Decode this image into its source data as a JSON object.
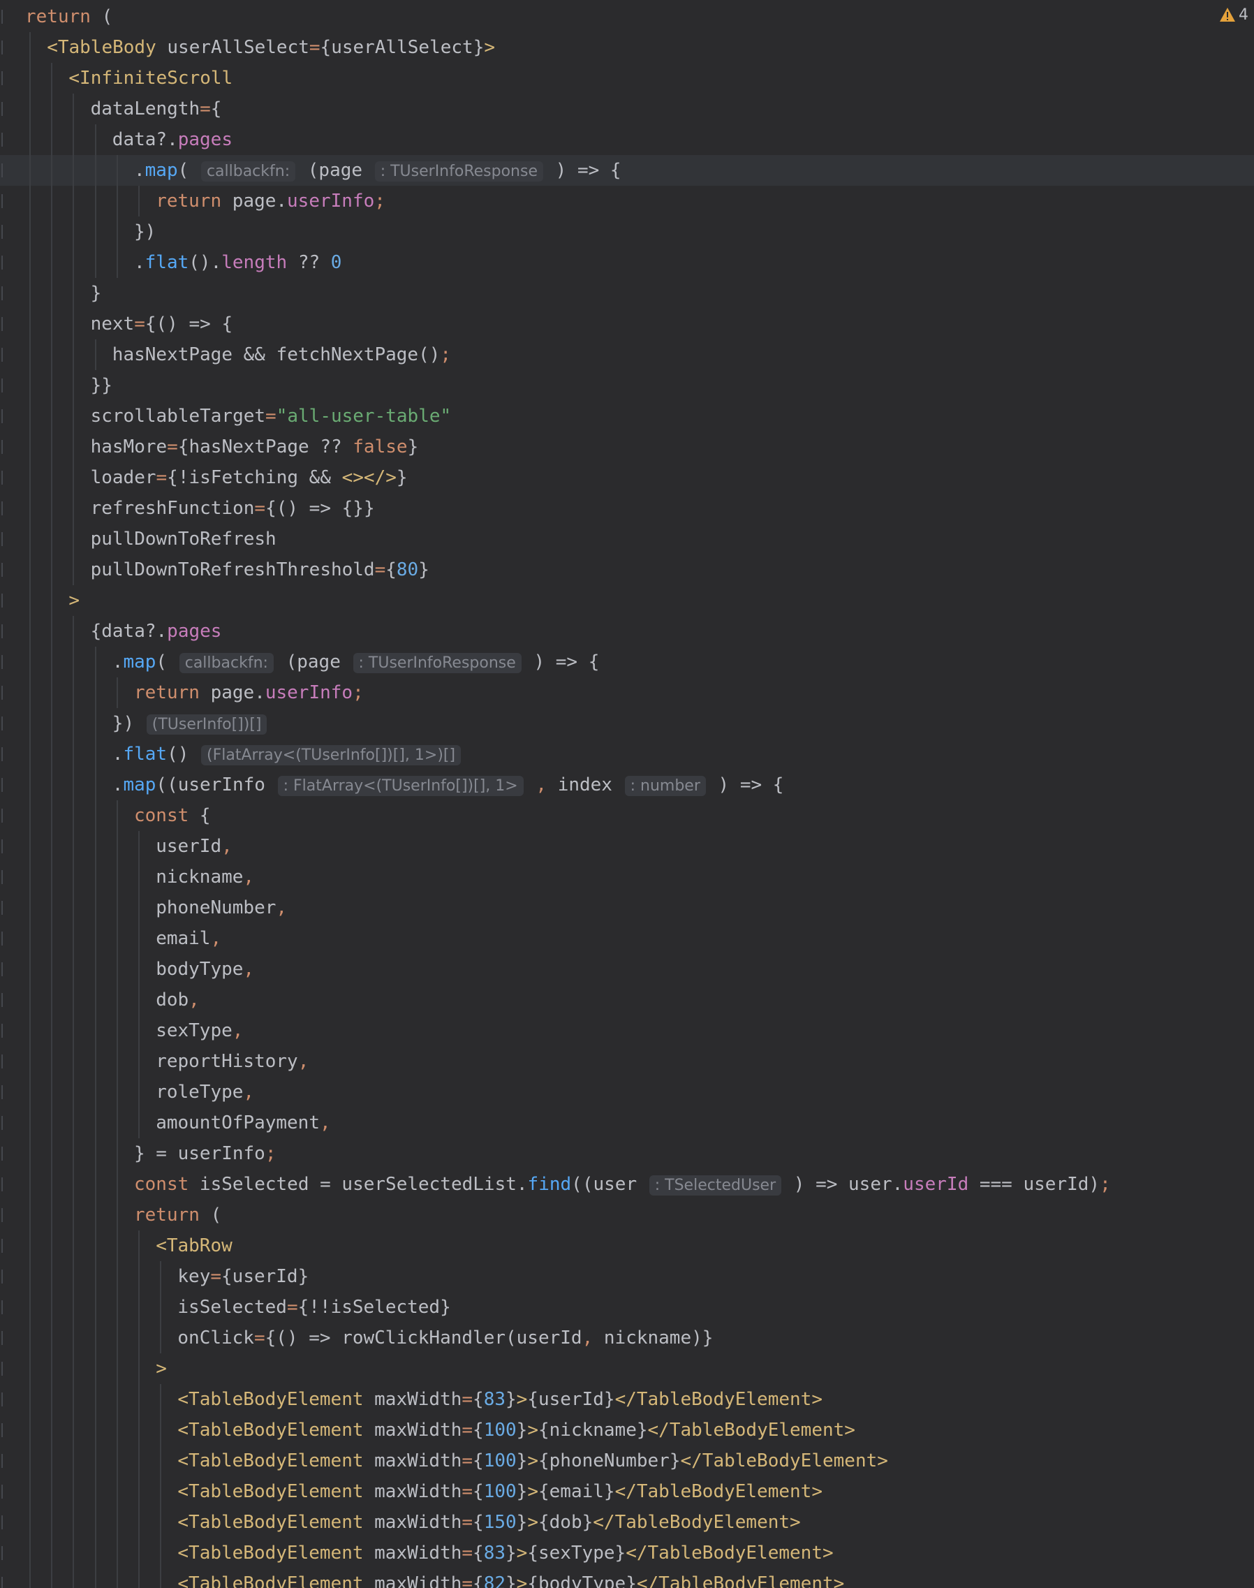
{
  "editor": {
    "warning_count": "4",
    "colors": {
      "background": "#2b2b2d",
      "text": "#bcbec4",
      "keyword": "#cf8e6d",
      "tag": "#d5b778",
      "number": "#6aabe4",
      "string": "#6aab73",
      "property": "#c77dbb",
      "function": "#56a8f5",
      "hint": "#868991",
      "warning": "#e5a23b"
    },
    "lines": [
      {
        "indent": 0,
        "tokens": [
          [
            "return",
            "kw"
          ],
          [
            " (",
            ""
          ]
        ]
      },
      {
        "indent": 1,
        "tokens": [
          [
            "<TableBody",
            "tag"
          ],
          [
            " userAllSelect",
            ""
          ],
          [
            "=",
            "kw"
          ],
          [
            "{userAllSelect}",
            ""
          ],
          [
            ">",
            "tag"
          ]
        ]
      },
      {
        "indent": 2,
        "tokens": [
          [
            "<InfiniteScroll",
            "tag"
          ]
        ]
      },
      {
        "indent": 3,
        "tokens": [
          [
            "dataLength",
            ""
          ],
          [
            "=",
            "kw"
          ],
          [
            "{",
            ""
          ]
        ]
      },
      {
        "indent": 4,
        "tokens": [
          [
            "data?.",
            ""
          ],
          [
            "pages",
            "prop"
          ]
        ]
      },
      {
        "indent": 5,
        "current": true,
        "tokens": [
          [
            ".",
            ""
          ],
          [
            "map",
            "fn"
          ],
          [
            "( ",
            ""
          ],
          [
            "callbackfn:",
            "hint"
          ],
          [
            " (page ",
            ""
          ],
          [
            ": TUserInfoResponse",
            "hint"
          ],
          [
            " ) => {",
            ""
          ]
        ]
      },
      {
        "indent": 6,
        "tokens": [
          [
            "return",
            "kw"
          ],
          [
            " page.",
            ""
          ],
          [
            "userInfo",
            "prop"
          ],
          [
            ";",
            "kw"
          ]
        ]
      },
      {
        "indent": 5,
        "tokens": [
          [
            "})",
            ""
          ]
        ]
      },
      {
        "indent": 5,
        "tokens": [
          [
            ".",
            ""
          ],
          [
            "flat",
            "fn"
          ],
          [
            "().",
            ""
          ],
          [
            "length",
            "prop"
          ],
          [
            " ?? ",
            ""
          ],
          [
            "0",
            "num"
          ]
        ]
      },
      {
        "indent": 3,
        "tokens": [
          [
            "}",
            ""
          ]
        ]
      },
      {
        "indent": 3,
        "tokens": [
          [
            "next",
            ""
          ],
          [
            "=",
            "kw"
          ],
          [
            "{() => {",
            ""
          ]
        ]
      },
      {
        "indent": 4,
        "tokens": [
          [
            "hasNextPage && fetchNextPage()",
            ""
          ],
          [
            ";",
            "kw"
          ]
        ]
      },
      {
        "indent": 3,
        "tokens": [
          [
            "}}",
            ""
          ]
        ]
      },
      {
        "indent": 3,
        "tokens": [
          [
            "scrollableTarget",
            ""
          ],
          [
            "=",
            "kw"
          ],
          [
            "\"all-user-table\"",
            "str"
          ]
        ]
      },
      {
        "indent": 3,
        "tokens": [
          [
            "hasMore",
            ""
          ],
          [
            "=",
            "kw"
          ],
          [
            "{hasNextPage ?? ",
            ""
          ],
          [
            "false",
            "kw"
          ],
          [
            "}",
            ""
          ]
        ]
      },
      {
        "indent": 3,
        "tokens": [
          [
            "loader",
            ""
          ],
          [
            "=",
            "kw"
          ],
          [
            "{!isFetching && ",
            ""
          ],
          [
            "<></>",
            "tag"
          ],
          [
            "}",
            ""
          ]
        ]
      },
      {
        "indent": 3,
        "tokens": [
          [
            "refreshFunction",
            ""
          ],
          [
            "=",
            "kw"
          ],
          [
            "{() => {}}",
            ""
          ]
        ]
      },
      {
        "indent": 3,
        "tokens": [
          [
            "pullDownToRefresh",
            ""
          ]
        ]
      },
      {
        "indent": 3,
        "tokens": [
          [
            "pullDownToRefreshThreshold",
            ""
          ],
          [
            "=",
            "kw"
          ],
          [
            "{",
            ""
          ],
          [
            "80",
            "num"
          ],
          [
            "}",
            ""
          ]
        ]
      },
      {
        "indent": 2,
        "tokens": [
          [
            ">",
            "tag"
          ]
        ]
      },
      {
        "indent": 3,
        "tokens": [
          [
            "{data?.",
            ""
          ],
          [
            "pages",
            "prop"
          ]
        ]
      },
      {
        "indent": 4,
        "tokens": [
          [
            ".",
            ""
          ],
          [
            "map",
            "fn"
          ],
          [
            "( ",
            ""
          ],
          [
            "callbackfn:",
            "hint"
          ],
          [
            " (page ",
            ""
          ],
          [
            ": TUserInfoResponse",
            "hint"
          ],
          [
            " ) => {",
            ""
          ]
        ]
      },
      {
        "indent": 5,
        "tokens": [
          [
            "return",
            "kw"
          ],
          [
            " page.",
            ""
          ],
          [
            "userInfo",
            "prop"
          ],
          [
            ";",
            "kw"
          ]
        ]
      },
      {
        "indent": 4,
        "tokens": [
          [
            "}) ",
            ""
          ],
          [
            "(TUserInfo[])[]",
            "hint"
          ]
        ]
      },
      {
        "indent": 4,
        "tokens": [
          [
            ".",
            ""
          ],
          [
            "flat",
            "fn"
          ],
          [
            "() ",
            ""
          ],
          [
            "(FlatArray<(TUserInfo[])[], 1>)[]",
            "hint"
          ]
        ]
      },
      {
        "indent": 4,
        "tokens": [
          [
            ".",
            ""
          ],
          [
            "map",
            "fn"
          ],
          [
            "((userInfo ",
            ""
          ],
          [
            ": FlatArray<(TUserInfo[])[], 1>",
            "hint"
          ],
          [
            " , ",
            "kw"
          ],
          [
            "index ",
            ""
          ],
          [
            ": number",
            "hint"
          ],
          [
            " ) => {",
            ""
          ]
        ]
      },
      {
        "indent": 5,
        "tokens": [
          [
            "const",
            "kw"
          ],
          [
            " {",
            ""
          ]
        ]
      },
      {
        "indent": 6,
        "tokens": [
          [
            "userId",
            ""
          ],
          [
            ",",
            "kw"
          ]
        ]
      },
      {
        "indent": 6,
        "tokens": [
          [
            "nickname",
            ""
          ],
          [
            ",",
            "kw"
          ]
        ]
      },
      {
        "indent": 6,
        "tokens": [
          [
            "phoneNumber",
            ""
          ],
          [
            ",",
            "kw"
          ]
        ]
      },
      {
        "indent": 6,
        "tokens": [
          [
            "email",
            ""
          ],
          [
            ",",
            "kw"
          ]
        ]
      },
      {
        "indent": 6,
        "tokens": [
          [
            "bodyType",
            ""
          ],
          [
            ",",
            "kw"
          ]
        ]
      },
      {
        "indent": 6,
        "tokens": [
          [
            "dob",
            ""
          ],
          [
            ",",
            "kw"
          ]
        ]
      },
      {
        "indent": 6,
        "tokens": [
          [
            "sexType",
            ""
          ],
          [
            ",",
            "kw"
          ]
        ]
      },
      {
        "indent": 6,
        "tokens": [
          [
            "reportHistory",
            ""
          ],
          [
            ",",
            "kw"
          ]
        ]
      },
      {
        "indent": 6,
        "tokens": [
          [
            "roleType",
            ""
          ],
          [
            ",",
            "kw"
          ]
        ]
      },
      {
        "indent": 6,
        "tokens": [
          [
            "amountOfPayment",
            ""
          ],
          [
            ",",
            "kw"
          ]
        ]
      },
      {
        "indent": 5,
        "tokens": [
          [
            "} = userInfo",
            ""
          ],
          [
            ";",
            "kw"
          ]
        ]
      },
      {
        "indent": 5,
        "tokens": [
          [
            "const",
            "kw"
          ],
          [
            " isSelected = userSelectedList.",
            ""
          ],
          [
            "find",
            "fn"
          ],
          [
            "((user ",
            ""
          ],
          [
            ": TSelectedUser",
            "hint"
          ],
          [
            " ) => user.",
            ""
          ],
          [
            "userId",
            "prop"
          ],
          [
            " === userId)",
            ""
          ],
          [
            ";",
            "kw"
          ]
        ]
      },
      {
        "indent": 5,
        "tokens": [
          [
            "return",
            "kw"
          ],
          [
            " (",
            ""
          ]
        ]
      },
      {
        "indent": 6,
        "tokens": [
          [
            "<TabRow",
            "tag"
          ]
        ]
      },
      {
        "indent": 7,
        "tokens": [
          [
            "key",
            ""
          ],
          [
            "=",
            "kw"
          ],
          [
            "{userId}",
            ""
          ]
        ]
      },
      {
        "indent": 7,
        "tokens": [
          [
            "isSelected",
            ""
          ],
          [
            "=",
            "kw"
          ],
          [
            "{!!isSelected}",
            ""
          ]
        ]
      },
      {
        "indent": 7,
        "tokens": [
          [
            "onClick",
            ""
          ],
          [
            "=",
            "kw"
          ],
          [
            "{() => rowClickHandler(userId",
            ""
          ],
          [
            ", ",
            "kw"
          ],
          [
            "nickname)}",
            ""
          ]
        ]
      },
      {
        "indent": 6,
        "tokens": [
          [
            ">",
            "tag"
          ]
        ]
      },
      {
        "indent": 7,
        "tokens": [
          [
            "<TableBodyElement",
            "tag"
          ],
          [
            " maxWidth",
            ""
          ],
          [
            "=",
            "kw"
          ],
          [
            "{",
            ""
          ],
          [
            "83",
            "num"
          ],
          [
            "}",
            ""
          ],
          [
            ">",
            "tag"
          ],
          [
            "{userId}",
            ""
          ],
          [
            "</TableBodyElement>",
            "tag"
          ]
        ]
      },
      {
        "indent": 7,
        "tokens": [
          [
            "<TableBodyElement",
            "tag"
          ],
          [
            " maxWidth",
            ""
          ],
          [
            "=",
            "kw"
          ],
          [
            "{",
            ""
          ],
          [
            "100",
            "num"
          ],
          [
            "}",
            ""
          ],
          [
            ">",
            "tag"
          ],
          [
            "{nickname}",
            ""
          ],
          [
            "</TableBodyElement>",
            "tag"
          ]
        ]
      },
      {
        "indent": 7,
        "tokens": [
          [
            "<TableBodyElement",
            "tag"
          ],
          [
            " maxWidth",
            ""
          ],
          [
            "=",
            "kw"
          ],
          [
            "{",
            ""
          ],
          [
            "100",
            "num"
          ],
          [
            "}",
            ""
          ],
          [
            ">",
            "tag"
          ],
          [
            "{phoneNumber}",
            ""
          ],
          [
            "</TableBodyElement>",
            "tag"
          ]
        ]
      },
      {
        "indent": 7,
        "tokens": [
          [
            "<TableBodyElement",
            "tag"
          ],
          [
            " maxWidth",
            ""
          ],
          [
            "=",
            "kw"
          ],
          [
            "{",
            ""
          ],
          [
            "100",
            "num"
          ],
          [
            "}",
            ""
          ],
          [
            ">",
            "tag"
          ],
          [
            "{email}",
            ""
          ],
          [
            "</TableBodyElement>",
            "tag"
          ]
        ]
      },
      {
        "indent": 7,
        "tokens": [
          [
            "<TableBodyElement",
            "tag"
          ],
          [
            " maxWidth",
            ""
          ],
          [
            "=",
            "kw"
          ],
          [
            "{",
            ""
          ],
          [
            "150",
            "num"
          ],
          [
            "}",
            ""
          ],
          [
            ">",
            "tag"
          ],
          [
            "{dob}",
            ""
          ],
          [
            "</TableBodyElement>",
            "tag"
          ]
        ]
      },
      {
        "indent": 7,
        "tokens": [
          [
            "<TableBodyElement",
            "tag"
          ],
          [
            " maxWidth",
            ""
          ],
          [
            "=",
            "kw"
          ],
          [
            "{",
            ""
          ],
          [
            "83",
            "num"
          ],
          [
            "}",
            ""
          ],
          [
            ">",
            "tag"
          ],
          [
            "{sexType}",
            ""
          ],
          [
            "</TableBodyElement>",
            "tag"
          ]
        ]
      },
      {
        "indent": 7,
        "tokens": [
          [
            "<TableBodyElement",
            "tag"
          ],
          [
            " maxWidth",
            ""
          ],
          [
            "=",
            "kw"
          ],
          [
            "{",
            ""
          ],
          [
            "82",
            "num"
          ],
          [
            "}",
            ""
          ],
          [
            ">",
            "tag"
          ],
          [
            "{bodyType}",
            ""
          ],
          [
            "</TableBodyElement>",
            "tag"
          ]
        ]
      }
    ]
  }
}
